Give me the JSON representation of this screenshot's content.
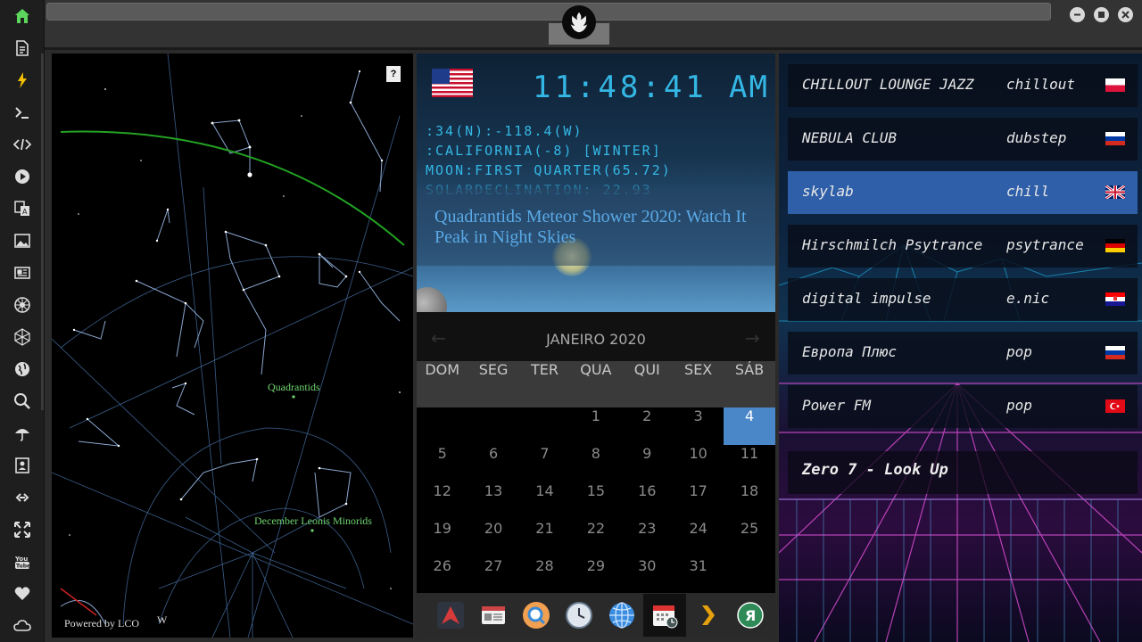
{
  "sidebar": {
    "icons": [
      "home-icon",
      "document-icon",
      "lightning-icon",
      "terminal-icon",
      "code-icon",
      "play-icon",
      "translate-icon",
      "image-icon",
      "newspaper-icon",
      "rebel-alliance-icon",
      "polyhedron-icon",
      "globe-icon",
      "search-icon",
      "umbrella-icon",
      "contacts-icon",
      "link-icon",
      "expand-icon",
      "youtube-icon",
      "heart-icon",
      "cloud-icon"
    ]
  },
  "starmap": {
    "help": "?",
    "powered_by": "Powered by LCO",
    "compass": "W",
    "labels": [
      "Quadrantids",
      "December Leonis Minorids"
    ]
  },
  "clock": {
    "time": "11:48:41",
    "ampm": "AM",
    "coords": ":34(N):-118.4(W)",
    "region": ":CALIFORNIA(-8) [WINTER]",
    "moon": "MOON:FIRST QUARTER(65.72)",
    "solar": "SOLARDECLINATION: 22.93"
  },
  "news": {
    "title": "Quadrantids Meteor Shower 2020: Watch It Peak in Night Skies"
  },
  "calendar": {
    "title": "JANEIRO 2020",
    "prev": "←",
    "next": "→",
    "days": [
      "DOM",
      "SEG",
      "TER",
      "QUA",
      "QUI",
      "SEX",
      "SÁB"
    ],
    "weeks": [
      [
        "",
        "",
        "",
        "1",
        "2",
        "3",
        "4"
      ],
      [
        "5",
        "6",
        "7",
        "8",
        "9",
        "10",
        "11"
      ],
      [
        "12",
        "13",
        "14",
        "15",
        "16",
        "17",
        "18"
      ],
      [
        "19",
        "20",
        "21",
        "22",
        "23",
        "24",
        "25"
      ],
      [
        "26",
        "27",
        "28",
        "29",
        "30",
        "31",
        ""
      ]
    ],
    "today": "4"
  },
  "dock": {
    "items": [
      "arrow-app-icon",
      "news-app-icon",
      "magnifier-app-icon",
      "clock-app-icon",
      "globe-app-icon",
      "calendar-app-icon",
      "plex-app-icon",
      "yandex-app-icon"
    ]
  },
  "radio": {
    "stations": [
      {
        "name": "CHILLOUT LOUNGE JAZZ",
        "genre": "chillout",
        "flag": "poland"
      },
      {
        "name": "NEBULA CLUB",
        "genre": "dubstep",
        "flag": "russia"
      },
      {
        "name": "skylab",
        "genre": "chill",
        "flag": "uk"
      },
      {
        "name": "Hirschmilch Psytrance",
        "genre": "psytrance",
        "flag": "germany"
      },
      {
        "name": "digital impulse",
        "genre": "e.nic",
        "flag": "croatia"
      },
      {
        "name": "Европа Плюс",
        "genre": "pop",
        "flag": "russia"
      },
      {
        "name": "Power FM",
        "genre": "pop",
        "flag": "turkey"
      }
    ],
    "active_index": 2,
    "now_playing": "Zero 7 - Look Up"
  },
  "colors": {
    "accent": "#34b7e4",
    "today": "#4a87c9",
    "active_station": "#2f5fa8",
    "star_label": "#6fd46f"
  }
}
